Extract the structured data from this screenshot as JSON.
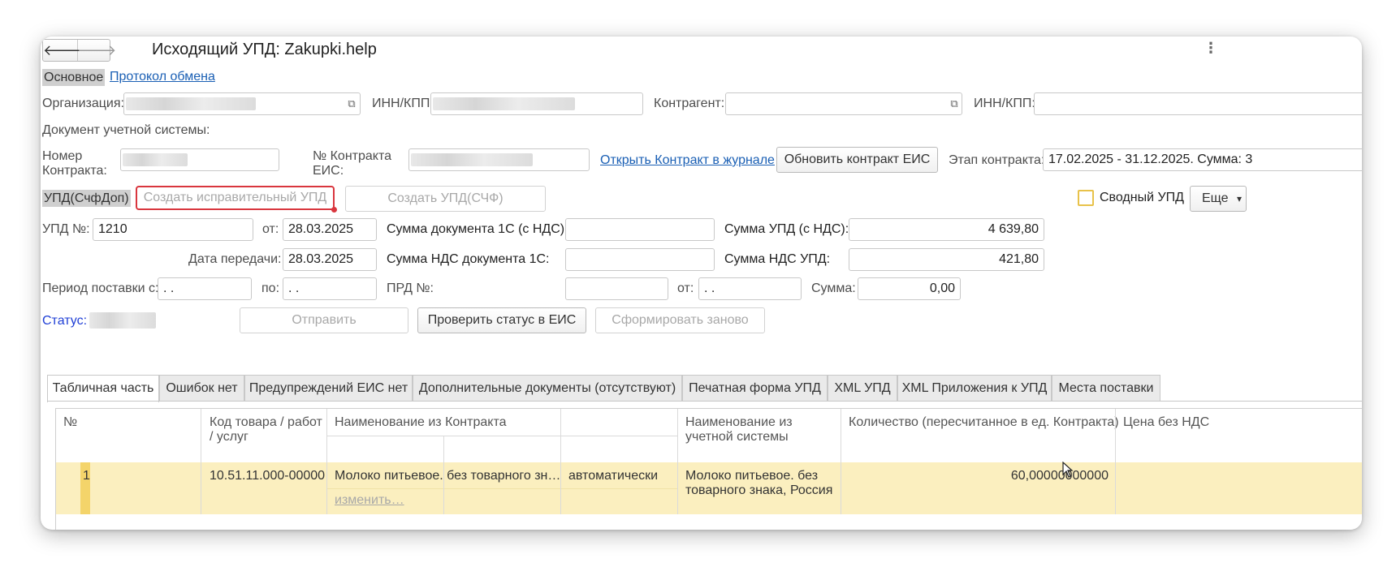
{
  "window": {
    "title": "Исходящий УПД: Zakupki.help"
  },
  "nav": {
    "back": "🡐",
    "forward": "🡒",
    "more": "⋮"
  },
  "top_tabs": [
    {
      "label": "Основное"
    },
    {
      "label": "Протокол обмена"
    }
  ],
  "org": {
    "label": "Организация:",
    "inn_label": "ИНН/КПП:",
    "contractor_label": "Контрагент:",
    "contractor_inn_label": "ИНН/КПП:"
  },
  "doc_section": {
    "label": "Документ учетной системы:"
  },
  "contract": {
    "number_label_1": "Номер",
    "number_label_2": "Контракта:",
    "eis_label_1": "№ Контракта",
    "eis_label_2": "ЕИС:",
    "open_link": "Открыть Контракт в журнале",
    "update_button": "Обновить контракт ЕИС",
    "stage_label": "Этап контракта:",
    "stage_value": "17.02.2025 - 31.12.2025. Сумма: 3"
  },
  "upd_toolbar": {
    "section_label": "УПД(СчфДоп)",
    "create_corrective": "Создать исправительный УПД",
    "create_upd": "Создать УПД(СЧФ)",
    "summary_checkbox": "Сводный УПД",
    "more_button": "Еще",
    "more_arrow": "▾"
  },
  "upd": {
    "number_label": "УПД №:",
    "number_value": "1210",
    "from_label": "от:",
    "date_value": "28.03.2025",
    "sum_1c_label": "Сумма документа 1С (с НДС):",
    "sum_upd_label": "Сумма УПД (с НДС):",
    "sum_upd_value": "4 639,80",
    "transfer_label": "Дата передачи:",
    "transfer_value": "28.03.2025",
    "vat_1c_label": "Сумма НДС документа 1С:",
    "vat_upd_label": "Сумма НДС УПД:",
    "vat_upd_value": "421,80",
    "period_label": "Период поставки с:",
    "period_from": " .  .",
    "period_to_label": "по:",
    "period_to": " .  .",
    "prd_label": "ПРД №:",
    "prd_from_label": "от:",
    "prd_from": " .  .",
    "sum_label": "Сумма:",
    "sum_value": "0,00"
  },
  "status": {
    "label": "Статус:",
    "send": "Отправить",
    "check": "Проверить статус в ЕИС",
    "regenerate": "Сформировать заново"
  },
  "tabs": [
    {
      "label": "Табличная часть"
    },
    {
      "label": "Ошибок нет"
    },
    {
      "label": "Предупреждений ЕИС нет"
    },
    {
      "label": "Дополнительные документы (отсутствуют)"
    },
    {
      "label": "Печатная форма УПД"
    },
    {
      "label": "XML УПД"
    },
    {
      "label": "XML Приложения к УПД"
    },
    {
      "label": "Места поставки"
    }
  ],
  "table": {
    "headers": {
      "num": "№",
      "code_1": "Код товара / работ",
      "code_2": "/ услуг",
      "name_contract": "Наименование из Контракта",
      "name_system_1": "Наименование из",
      "name_system_2": "учетной системы",
      "qty": "Количество (пересчитанное в ед. Контракта)",
      "price": "Цена без НДС"
    },
    "rows": [
      {
        "num": "1",
        "code": "10.51.11.000-00000",
        "name_contract": "Молоко питьевое. без товарного зн…",
        "change_link": "изменить…",
        "mode": "автоматически",
        "name_system_1": "Молоко питьевое. без",
        "name_system_2": "товарного знака, Россия",
        "qty": "60,00000000000"
      }
    ]
  },
  "colors": {
    "accent_red": "#d9363e",
    "link": "#1a5fb4",
    "row_highlight": "#fbefbf",
    "checkbox_border": "#e8c24a"
  }
}
